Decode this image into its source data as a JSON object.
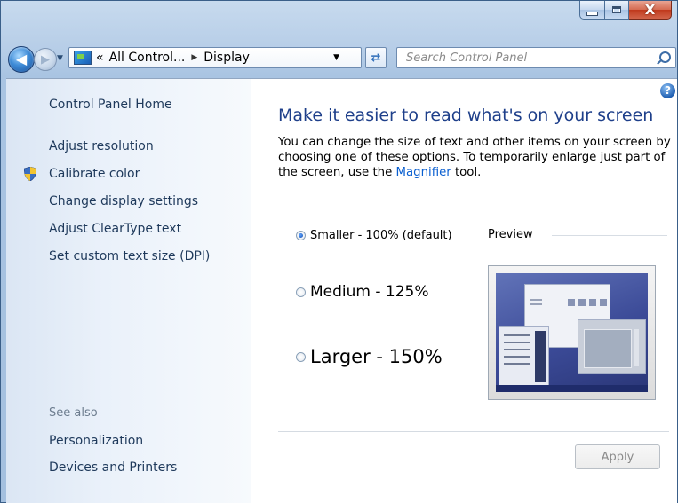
{
  "window": {
    "close_symbol": "X"
  },
  "nav": {
    "breadcrumb_prefix": "«",
    "crumbs": [
      "All Control...",
      "Display"
    ],
    "search_placeholder": "Search Control Panel"
  },
  "sidebar": {
    "home": "Control Panel Home",
    "links": [
      "Adjust resolution",
      "Calibrate color",
      "Change display settings",
      "Adjust ClearType text",
      "Set custom text size (DPI)"
    ],
    "see_also_heading": "See also",
    "see_also_links": [
      "Personalization",
      "Devices and Printers"
    ]
  },
  "main": {
    "title": "Make it easier to read what's on your screen",
    "description_before": "You can change the size of text and other items on your screen by choosing one of these options. To temporarily enlarge just part of the screen, use the ",
    "magnifier_link": "Magnifier",
    "description_after": " tool.",
    "options": [
      {
        "label": "Smaller - 100% (default)",
        "selected": true
      },
      {
        "label": "Medium - 125%",
        "selected": false
      },
      {
        "label": "Larger - 150%",
        "selected": false
      }
    ],
    "preview_label": "Preview",
    "apply_label": "Apply",
    "help_symbol": "?"
  },
  "colors": {
    "link": "#1e395b",
    "title": "#1e3f8a",
    "hyperlink": "#0a5fd0"
  }
}
